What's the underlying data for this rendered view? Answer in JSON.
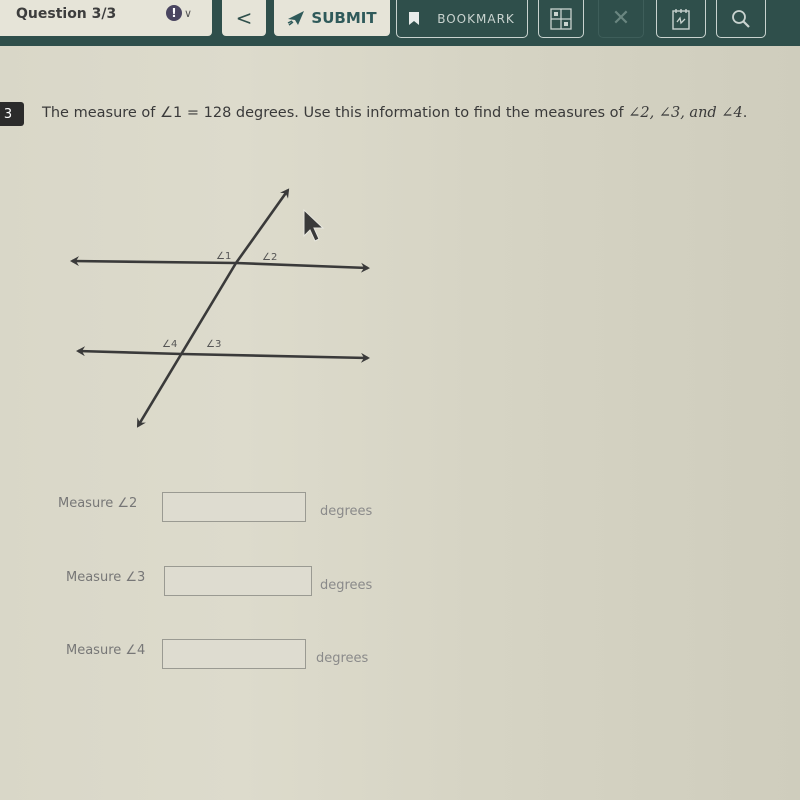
{
  "header": {
    "question_label": "Question 3/3",
    "flag_icon": "exclamation-flag-icon",
    "flag_glyph": "!",
    "chevron_glyph": "∨",
    "back_glyph": "<",
    "submit_label": "SUBMIT",
    "bookmark_label": "BOOKMARK",
    "close_glyph": "✕"
  },
  "question": {
    "number": "3",
    "text_part1": "The measure of ",
    "angle1": "∠1",
    "text_part2": " = 128 degrees. Use this information to find the measures of ",
    "angles_list": "∠2,  ∠3,  and ∠4",
    "text_end": "."
  },
  "diagram": {
    "labels": {
      "angle1": "∠1",
      "angle2": "∠2",
      "angle3": "∠3",
      "angle4": "∠4"
    }
  },
  "answers": [
    {
      "label": "Measure ∠2",
      "value": "",
      "unit": "degrees"
    },
    {
      "label": "Measure ∠3",
      "value": "",
      "unit": "degrees"
    },
    {
      "label": "Measure ∠4",
      "value": "",
      "unit": "degrees"
    }
  ],
  "colors": {
    "header_bg": "#2f4f4b",
    "page_bg": "#dad8c9"
  }
}
